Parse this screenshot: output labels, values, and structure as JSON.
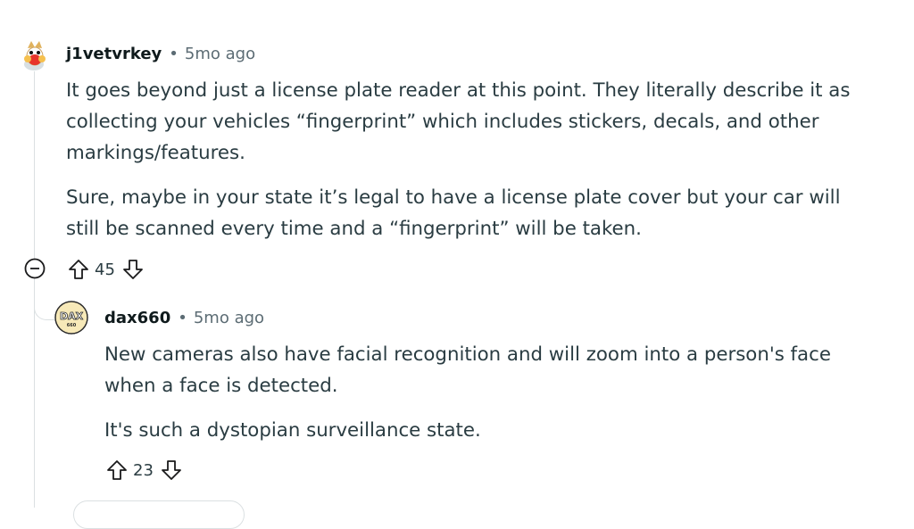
{
  "comments": [
    {
      "username": "j1vetvrkey",
      "age": "5mo ago",
      "paragraphs": [
        "It goes beyond just a license plate reader at this point. They literally describe it as collecting your vehicles “fingerprint” which includes stickers, decals, and other markings/features.",
        "Sure, maybe in your state it’s legal to have a license plate cover but your car will still be scanned every time and a “fingerprint” will be taken."
      ],
      "score": "45",
      "avatar_icon": "snoo-avatar-icon"
    },
    {
      "username": "dax660",
      "age": "5mo ago",
      "paragraphs": [
        "New cameras also have facial recognition and will zoom into a person's face when a face is detected.",
        "It's such a dystopian surveillance state."
      ],
      "score": "23",
      "avatar_icon": "dax-avatar-icon",
      "avatar_text": "DAX",
      "avatar_subtext": "660"
    }
  ],
  "separator": "•",
  "colors": {
    "text": "#2a3c42",
    "username": "#0f1a1c",
    "meta": "#5c6c74",
    "thread_line": "#dbe0e2"
  }
}
